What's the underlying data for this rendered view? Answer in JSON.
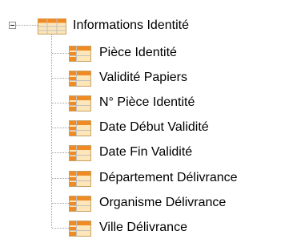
{
  "tree": {
    "root": {
      "label": "Informations Identité",
      "icon": "table-icon",
      "expanded": true
    },
    "children": [
      {
        "label": "Pièce Identité",
        "icon": "field-icon"
      },
      {
        "label": "Validité Papiers",
        "icon": "field-icon"
      },
      {
        "label": "N° Pièce Identité",
        "icon": "field-icon"
      },
      {
        "label": "Date Début Validité",
        "icon": "field-icon"
      },
      {
        "label": "Date Fin Validité",
        "icon": "field-icon"
      },
      {
        "label": "Département Délivrance",
        "icon": "field-icon"
      },
      {
        "label": "Organisme Délivrance",
        "icon": "field-icon"
      },
      {
        "label": "Ville Délivrance",
        "icon": "field-icon"
      }
    ]
  },
  "colors": {
    "connector": "#a0a0a0",
    "icon_orange": "#f08a24",
    "icon_light": "#fde6b8",
    "icon_grid": "#c0c0c0"
  }
}
